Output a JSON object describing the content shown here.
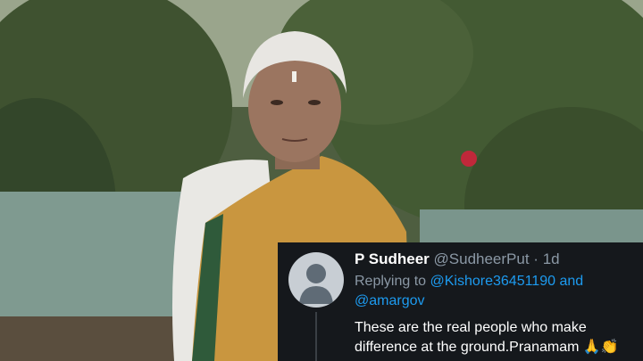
{
  "photo": {
    "description_icon": "photo-scene"
  },
  "tweet": {
    "display_name": "P Sudheer",
    "handle": "@SudheerPut",
    "separator": "·",
    "time": "1d",
    "replying_prefix": "Replying to",
    "mention_1": "@Kishore36451190",
    "conjunction": "and",
    "mention_2": "@amargov",
    "body": "These are the real people who make difference at the ground.Pranamam",
    "emoji": "🙏👏",
    "colors": {
      "background": "#15181c",
      "link": "#1d9bf0",
      "muted": "#8b98a5"
    }
  }
}
